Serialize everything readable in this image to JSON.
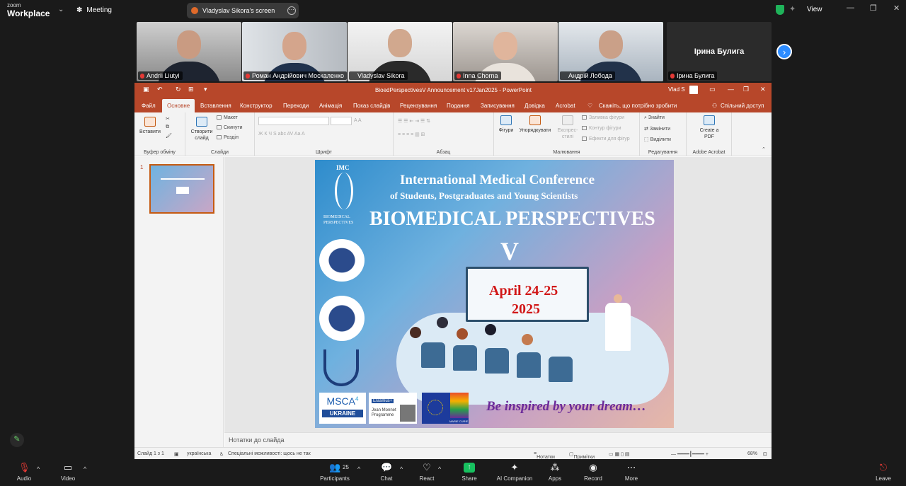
{
  "zoom": {
    "brand_small": "zoom",
    "brand": "Workplace",
    "meeting_label": "Meeting",
    "screen_share_label": "Vladyslav Sikora's screen",
    "view_label": "View",
    "participants_count": "25"
  },
  "participants": [
    {
      "name": "Andrii Liutyi"
    },
    {
      "name": "Роман Андрійович Москаленко"
    },
    {
      "name": "Vladyslav Sikora"
    },
    {
      "name": "Inna Chorna"
    },
    {
      "name": "Андрій Лобода"
    },
    {
      "name": "Ірина Булига",
      "display_name": "Ірина Булига"
    }
  ],
  "ppt": {
    "title": "BioedPerspectivesV Announcement v17Jan2025  -  PowerPoint",
    "user": "Vlad S",
    "tabs": [
      "Файл",
      "Основне",
      "Вставлення",
      "Конструктор",
      "Переходи",
      "Анімація",
      "Показ слайдів",
      "Рецензування",
      "Подання",
      "Записування",
      "Довідка",
      "Acrobat"
    ],
    "tell_me": "Скажіть, що потрібно зробити",
    "share": "Спільний доступ",
    "ribbon": {
      "paste": "Вставити",
      "clipboard": "Буфер обміну",
      "new_slide": "Створити слайд",
      "layout": "Макет",
      "reset": "Скинути",
      "section": "Розділ",
      "slides": "Слайди",
      "font": "Шрифт",
      "paragraph": "Абзац",
      "shapes": "Фігури",
      "arrange": "Упорядкувати",
      "quick_styles": "Експрес-стилі",
      "shape_fill": "Заливка фігури",
      "shape_outline": "Контур фігури",
      "shape_effects": "Ефекти для фігур",
      "drawing": "Малювання",
      "find": "Знайти",
      "replace": "Замінити",
      "select": "Виділити",
      "editing": "Редагування",
      "create_pdf": "Create a PDF",
      "adobe": "Adobe Acrobat"
    },
    "slide_number": "1",
    "notes_placeholder": "Нотатки до слайда",
    "status": {
      "slide_of": "Слайд 1 з 1",
      "language": "українська",
      "accessibility": "Спеціальні можливості: щось не так",
      "notes_btn": "Нотатки",
      "comments_btn": "Примітки",
      "zoom": "68%"
    }
  },
  "slide": {
    "imc": "IMC",
    "dna_caption_1": "BIOMEDICAL",
    "dna_caption_2": "PERSPECTIVES",
    "line1": "International Medical Conference",
    "line2": "of Students, Postgraduates and Young Scientists",
    "title": "BIOMEDICAL  PERSPECTIVES",
    "roman": "V",
    "date1": "April 24-25",
    "date2": "2025",
    "slogan": "Be inspired by your dream…",
    "msca": "MSCA",
    "msca_num": "4",
    "ukraine": "UKRAINE",
    "erasmus": "Erasmus+",
    "jean_monnet": "Jean Monnet Programme",
    "marie_curie": "MARIE CURIE"
  },
  "toolbar": [
    "Audio",
    "Video",
    "Participants",
    "Chat",
    "React",
    "Share",
    "AI Companion",
    "Apps",
    "Record",
    "More",
    "Leave"
  ],
  "colors": {
    "ppt_accent": "#b7472a",
    "zoom_blue": "#2d8cff",
    "share_green": "#17c15f",
    "active_speaker": "#2ecc71"
  }
}
